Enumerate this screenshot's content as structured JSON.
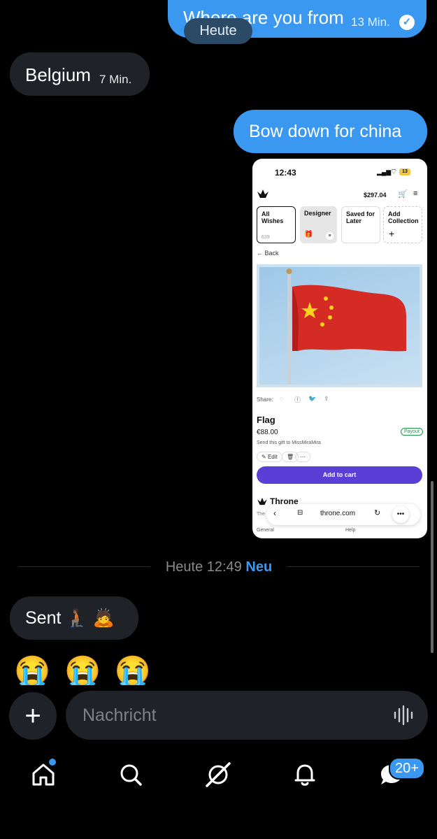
{
  "chat": {
    "messages": [
      {
        "text": "Where are you from",
        "time": "13 Min.",
        "direction": "out",
        "read": true
      },
      {
        "text": "Belgium",
        "time": "7 Min.",
        "direction": "in"
      },
      {
        "text": "Bow down for china",
        "direction": "out"
      },
      {
        "text": "Sent 🧎🏾 🙇",
        "direction": "in"
      },
      {
        "text": "😭 😭 😭",
        "direction": "in"
      }
    ],
    "date_pill": "Heute",
    "divider": {
      "label": "Heute 12:49",
      "new_label": "Neu"
    }
  },
  "shared_screenshot": {
    "status_time": "12:43",
    "battery": "13",
    "cart_total": "$297.04",
    "tiles": [
      {
        "label": "All Wishes",
        "count": "639"
      },
      {
        "label": "Designer"
      },
      {
        "label": "Saved for Later"
      },
      {
        "label": "Add Collection"
      }
    ],
    "back_label": "Back",
    "share_label": "Share:",
    "product_name": "Flag",
    "price": "€88.00",
    "payout_badge": "Payout",
    "send_note": "Send this gift to MissMiraMira",
    "edit_label": "Edit",
    "add_to_cart": "Add to cart",
    "brand": "Throne",
    "url": "throne.com",
    "footer_general": "General",
    "footer_help": "Help",
    "accent_color": "#5a3fd6"
  },
  "composer": {
    "placeholder": "Nachricht"
  },
  "bottom_nav": {
    "messages_badge": "20+"
  },
  "colors": {
    "outgoing_bubble": "#3b98f0",
    "incoming_bubble": "#1f2226",
    "new_label": "#3b98f0"
  }
}
